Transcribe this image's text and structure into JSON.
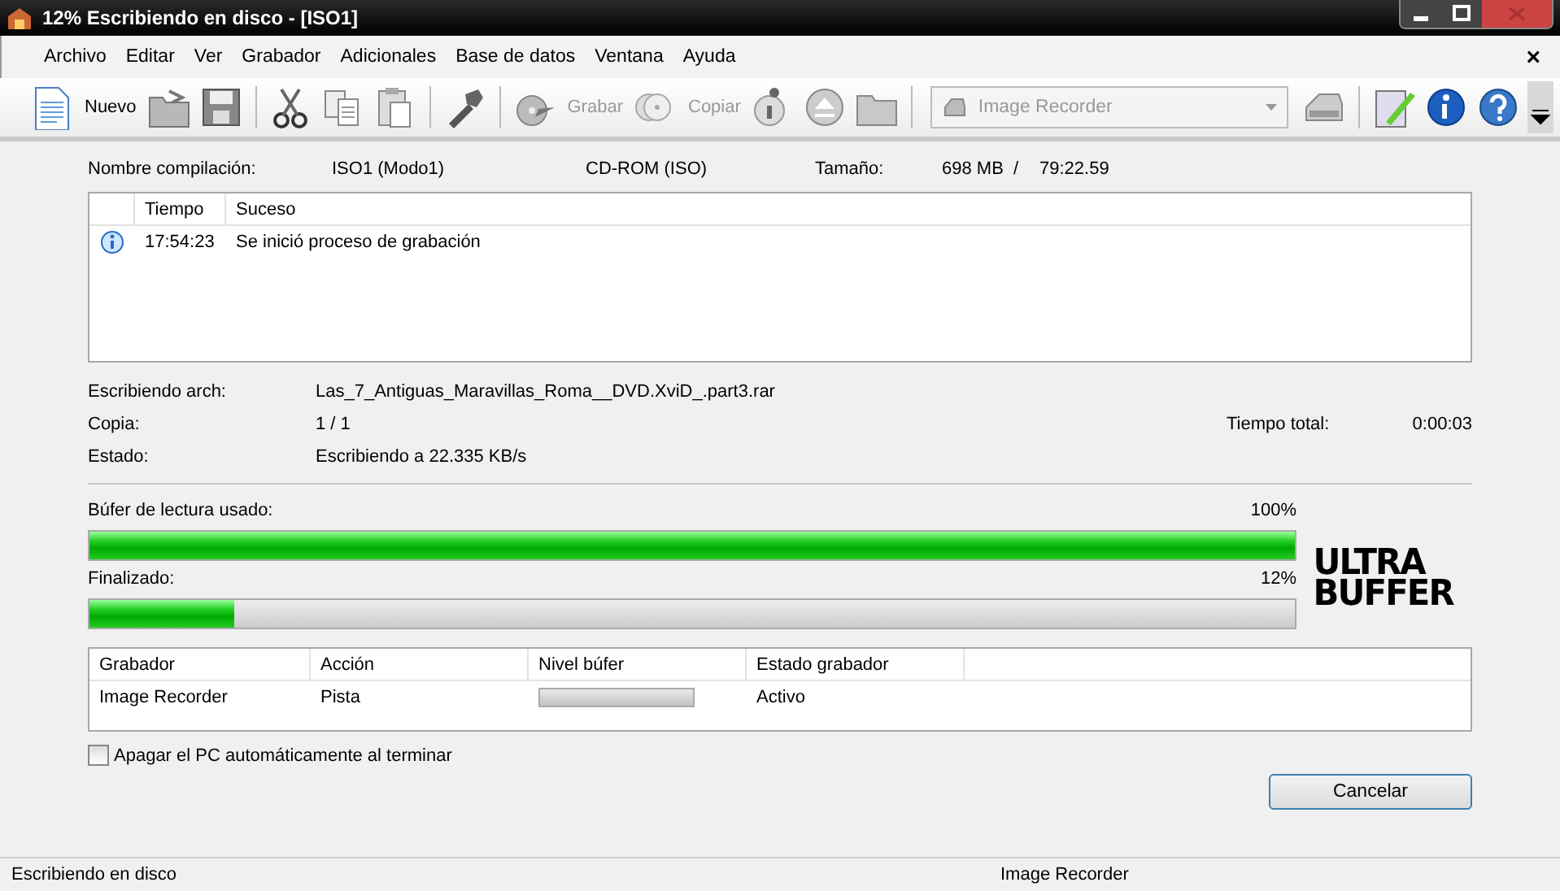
{
  "window": {
    "title": "12% Escribiendo en disco - [ISO1]"
  },
  "menu": {
    "items": [
      "Archivo",
      "Editar",
      "Ver",
      "Grabador",
      "Adicionales",
      "Base de datos",
      "Ventana",
      "Ayuda"
    ],
    "close": "×"
  },
  "toolbar": {
    "buttons": [
      {
        "label": "Nuevo",
        "disabled": false
      },
      {
        "label": "Grabar",
        "disabled": true
      },
      {
        "label": "Copiar",
        "disabled": true
      }
    ],
    "recorder": {
      "value": "Image Recorder",
      "disabled": true
    }
  },
  "info": {
    "name_label": "Nombre compilación:",
    "name_value": "ISO1 (Modo1)",
    "type": "CD-ROM (ISO)",
    "size_label": "Tamaño:",
    "size_value": "698 MB",
    "separator": "/",
    "duration": "79:22.59"
  },
  "log": {
    "columns": [
      "Tiempo",
      "Suceso"
    ],
    "rows": [
      {
        "time": "17:54:23",
        "event": "Se inició proceso de grabación"
      }
    ]
  },
  "details": [
    {
      "label": "Escribiendo arch:",
      "value": "Las_7_Antiguas_Maravillas_Roma__DVD.XviD_.part3.rar"
    },
    {
      "label": "Copia:",
      "value": "1 / 1"
    },
    {
      "label": "Estado:",
      "value": "Escribiendo a 22.335 KB/s"
    }
  ],
  "total_time": {
    "label": "Tiempo total:",
    "value": "0:00:03"
  },
  "progress": [
    {
      "label": "Búfer de lectura usado:",
      "reading": "100%",
      "level": 1
    },
    {
      "label": "Finalizado:",
      "reading": "12%",
      "level": 0.12
    }
  ],
  "logo": {
    "lines": [
      "ULTRA",
      "BUFFER"
    ]
  },
  "drives": {
    "columns": [
      "Grabador",
      "Acción",
      "Nivel búfer",
      "Estado grabador"
    ],
    "rows": [
      {
        "recorder": "Image Recorder",
        "action": "Pista",
        "state": "Activo"
      }
    ]
  },
  "shutdown": {
    "label": "Apagar el PC automáticamente al terminar",
    "checked": false
  },
  "cancel": "Cancelar",
  "status_bar": [
    "Escribiendo en disco",
    "Image Recorder"
  ]
}
